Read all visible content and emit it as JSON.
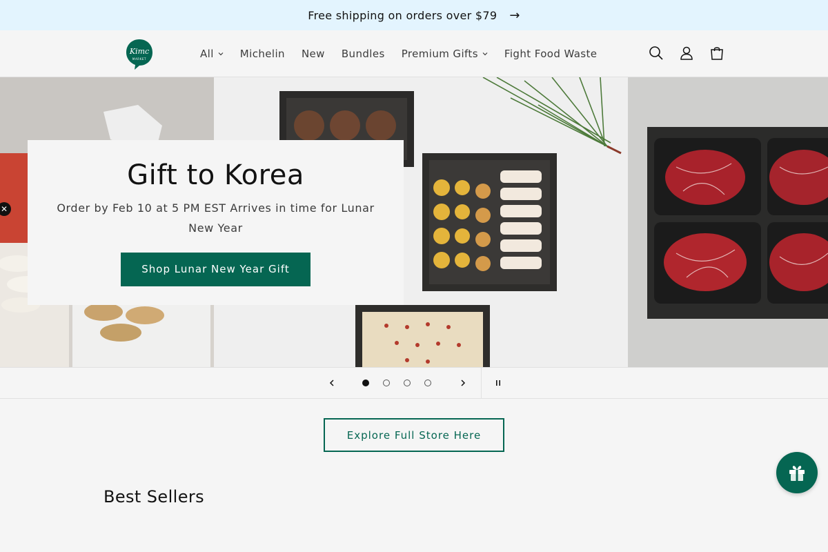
{
  "announcement": {
    "text": "Free shipping on orders over $79",
    "arrow": "→"
  },
  "header": {
    "logo_alt": "Kimc Market",
    "nav": [
      {
        "label": "All",
        "has_dropdown": true
      },
      {
        "label": "Michelin",
        "has_dropdown": false
      },
      {
        "label": "New",
        "has_dropdown": false
      },
      {
        "label": "Bundles",
        "has_dropdown": false
      },
      {
        "label": "Premium Gifts",
        "has_dropdown": true
      },
      {
        "label": "Fight Food Waste",
        "has_dropdown": false
      }
    ],
    "icons": [
      "search-icon",
      "account-icon",
      "cart-icon"
    ]
  },
  "hero": {
    "title": "Gift to Korea",
    "subtitle": "Order by Feb 10 at 5 PM EST Arrives in time for Lunar New Year",
    "button": "Shop Lunar New Year Gift",
    "side_close": "✕"
  },
  "slider": {
    "total_slides": 4,
    "active_index": 0
  },
  "explore_button": "Explore Full Store Here",
  "best_sellers_title": "Best Sellers",
  "colors": {
    "brand": "#056652",
    "announcement_bg": "#e3f4fe",
    "page_bg": "#f5f5f5"
  }
}
